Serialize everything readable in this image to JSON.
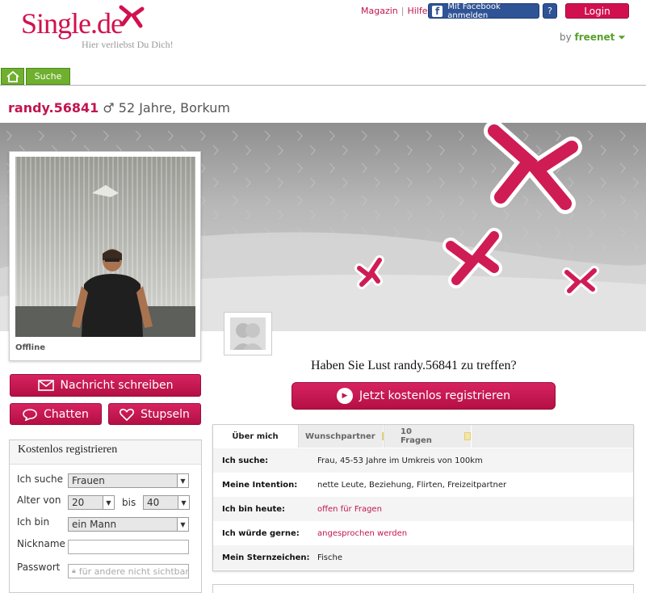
{
  "header": {
    "brand_name": "Single",
    "brand_tld": ".de",
    "tagline": "Hier verliebst Du Dich!",
    "links": {
      "magazin": "Magazin",
      "separator": "|",
      "hilfe": "Hilfe"
    },
    "facebook_button": "Mit Facebook anmelden",
    "help_button": "?",
    "login_button": "Login",
    "by_label": "by",
    "partner": "freenet"
  },
  "nav": {
    "suche": "Suche"
  },
  "profile": {
    "username": "randy.56841",
    "gender_symbol": "♂",
    "age_location": "52 Jahre, Borkum",
    "status": "Offline"
  },
  "actions": {
    "message": "Nachricht schreiben",
    "chat": "Chatten",
    "nudge": "Stupseln"
  },
  "register": {
    "title": "Kostenlos registrieren",
    "fields": {
      "looking_for_label": "Ich suche",
      "looking_for_value": "Frauen",
      "age_label": "Alter von",
      "age_from": "20",
      "age_to_label": "bis",
      "age_to": "40",
      "i_am_label": "Ich bin",
      "i_am_value": "ein Mann",
      "nickname_label": "Nickname",
      "password_label": "Passwort",
      "password_placeholder": "für andere nicht sichtbar"
    }
  },
  "meet": {
    "question": "Haben Sie Lust randy.56841 zu treffen?",
    "cta": "Jetzt kostenlos registrieren"
  },
  "tabs": [
    "Über mich",
    "Wunschpartner",
    "10 Fragen"
  ],
  "about": [
    {
      "key": "Ich suche:",
      "value": "Frau, 45-53 Jahre im Umkreis von 100km",
      "highlight": false
    },
    {
      "key": "Meine Intention:",
      "value": "nette Leute, Beziehung, Flirten, Freizeitpartner",
      "highlight": false
    },
    {
      "key": "Ich bin heute:",
      "value": "offen für Fragen",
      "highlight": true
    },
    {
      "key": "Ich würde gerne:",
      "value": "angesprochen werden",
      "highlight": true
    },
    {
      "key": "Mein Sternzeichen:",
      "value": "Fische",
      "highlight": false
    }
  ],
  "colors": {
    "brand_pink": "#d1114f",
    "nav_green": "#6fb02e",
    "facebook_blue": "#2f5496"
  }
}
